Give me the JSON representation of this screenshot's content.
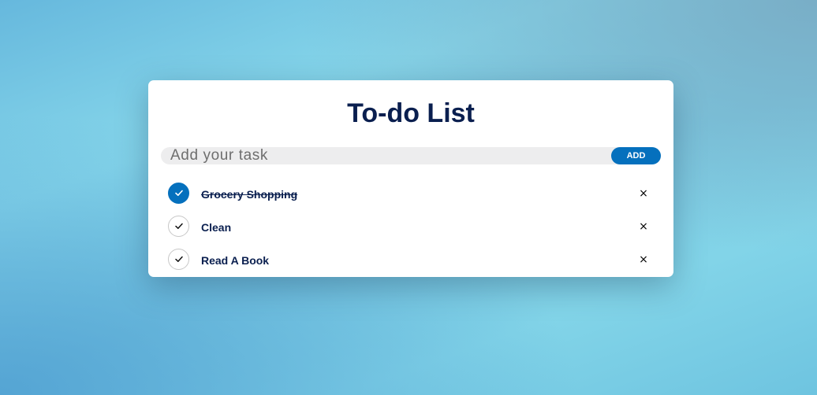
{
  "app": {
    "title": "To-do List"
  },
  "input": {
    "placeholder": "Add your task",
    "value": "",
    "add_label": "ADD"
  },
  "tasks": [
    {
      "text": "Grocery Shopping",
      "checked": true,
      "remove_icon": "close-icon",
      "remove_symbol": "×"
    },
    {
      "text": "Clean",
      "checked": false,
      "remove_icon": "close-icon",
      "remove_symbol": "×"
    },
    {
      "text": "Read A Book",
      "checked": false,
      "remove_icon": "close-icon",
      "remove_symbol": "×"
    }
  ],
  "colors": {
    "accent": "#0570bd",
    "title": "#0a1f4f",
    "input_bg": "#ededee"
  }
}
